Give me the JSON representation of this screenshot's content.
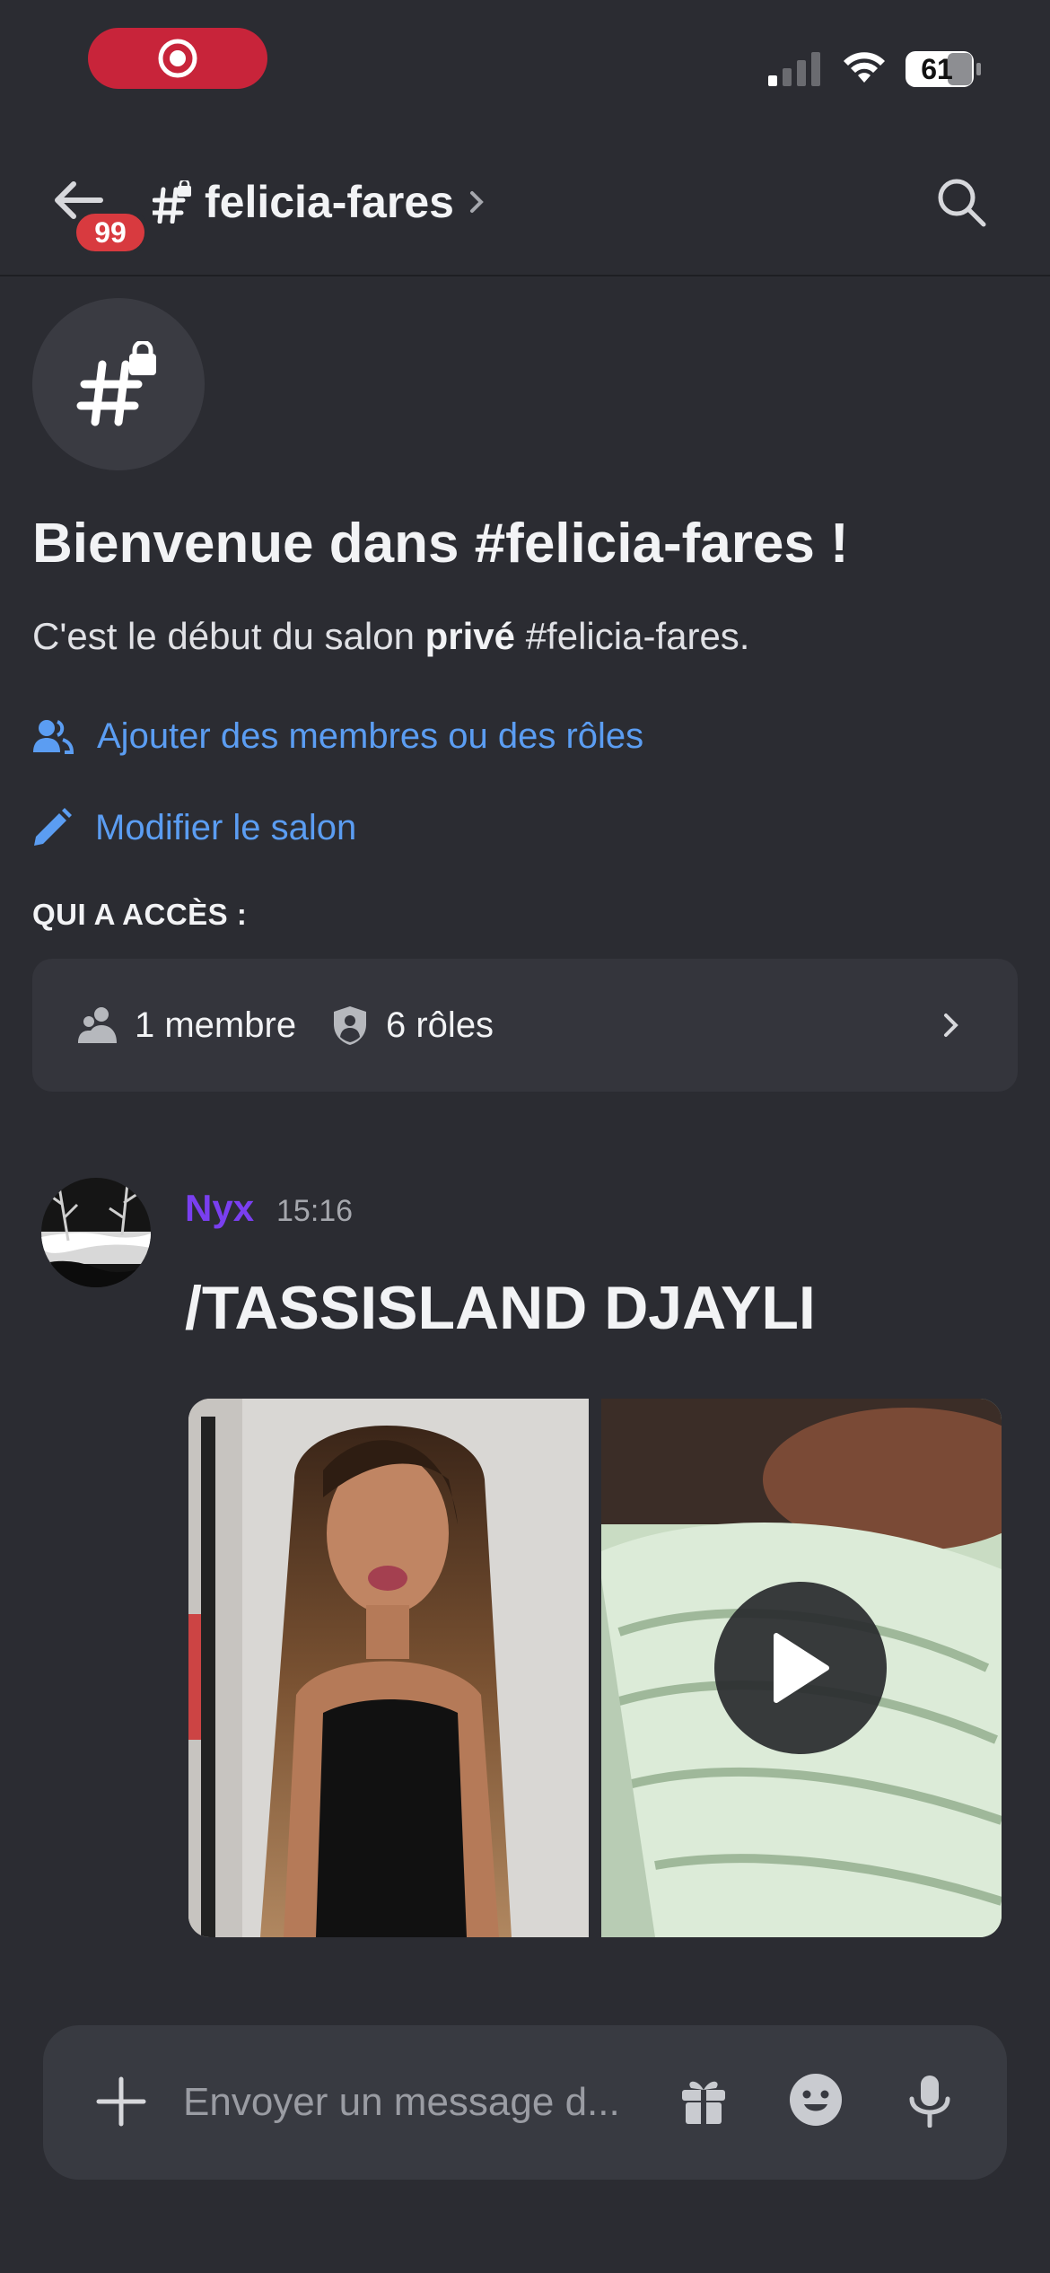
{
  "status_bar": {
    "battery_level": "61",
    "signal_bars_active": 1,
    "signal_bars_total": 4
  },
  "header": {
    "channel_name": "felicia-fares",
    "unread_badge": "99"
  },
  "welcome": {
    "title": "Bienvenue dans #felicia-fares !",
    "subtitle_pre": "C'est le début du salon ",
    "subtitle_bold": "privé",
    "subtitle_post": " #felicia-fares.",
    "add_members_label": "Ajouter des membres ou des rôles",
    "edit_channel_label": "Modifier le salon",
    "access_heading": "QUI A ACCÈS :",
    "members_count": "1 membre",
    "roles_count": "6 rôles"
  },
  "message": {
    "author": "Nyx",
    "time": "15:16",
    "text": "/TASSISLAND DJAYLI"
  },
  "composer": {
    "placeholder": "Envoyer un message d..."
  },
  "colors": {
    "background": "#2b2c32",
    "accent_link": "#5b9df2",
    "author_color": "#7a3ff0",
    "badge_red": "#d83a3f",
    "recording_pill": "#c8243a"
  },
  "icons": [
    "record-icon",
    "signal-icon",
    "wifi-icon",
    "battery-icon",
    "back-arrow-icon",
    "hashtag-lock-icon",
    "chevron-right-icon",
    "search-icon",
    "members-icon",
    "pencil-icon",
    "people-icon",
    "shield-person-icon",
    "play-icon",
    "plus-icon",
    "gift-icon",
    "emoji-icon",
    "mic-icon"
  ]
}
